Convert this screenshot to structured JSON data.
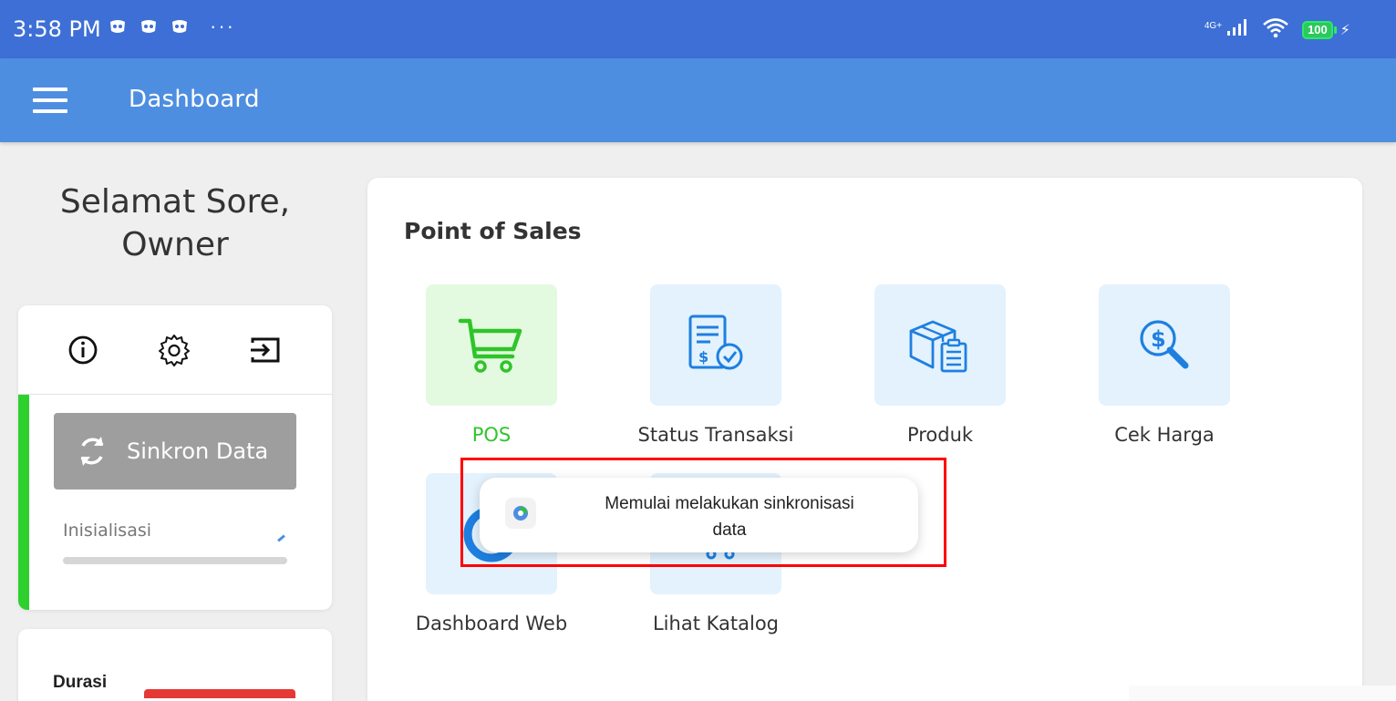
{
  "status_bar": {
    "time": "3:58 PM",
    "more": "···",
    "network_label": "4G+",
    "battery": "100",
    "icons": [
      "notification-app-icon",
      "notification-app-icon",
      "notification-app-icon",
      "signal-icon",
      "wifi-icon",
      "battery-icon",
      "charging-icon"
    ]
  },
  "app_bar": {
    "title": "Dashboard",
    "menu_icon": "hamburger-menu-icon"
  },
  "sidebar": {
    "greeting_line1": "Selamat Sore,",
    "greeting_line2": "Owner",
    "tools": [
      "info-icon",
      "gear-icon",
      "logout-icon"
    ],
    "sync_button_label": "Sinkron Data",
    "init_label": "Inisialisasi",
    "durasi_label": "Durasi",
    "accent_color": "#2ed02e"
  },
  "main": {
    "section_title": "Point of Sales",
    "tiles": [
      {
        "label": "POS",
        "icon": "cart-icon"
      },
      {
        "label": "Status Transaksi",
        "icon": "transaction-status-icon"
      },
      {
        "label": "Produk",
        "icon": "product-box-icon"
      },
      {
        "label": "Cek Harga",
        "icon": "price-check-icon"
      },
      {
        "label": "Dashboard Web",
        "icon": "dashboard-web-icon"
      },
      {
        "label": "Lihat Katalog",
        "icon": "catalog-icon"
      }
    ]
  },
  "toast": {
    "message_line1": "Memulai melakukan sinkronisasi",
    "message_line2": "data",
    "highlight_color": "#ff0000"
  },
  "colors": {
    "status_bar": "#3d6fd6",
    "app_bar": "#4e8ee0",
    "pos_green": "#31c42c",
    "icon_blue": "#1e88e5"
  }
}
